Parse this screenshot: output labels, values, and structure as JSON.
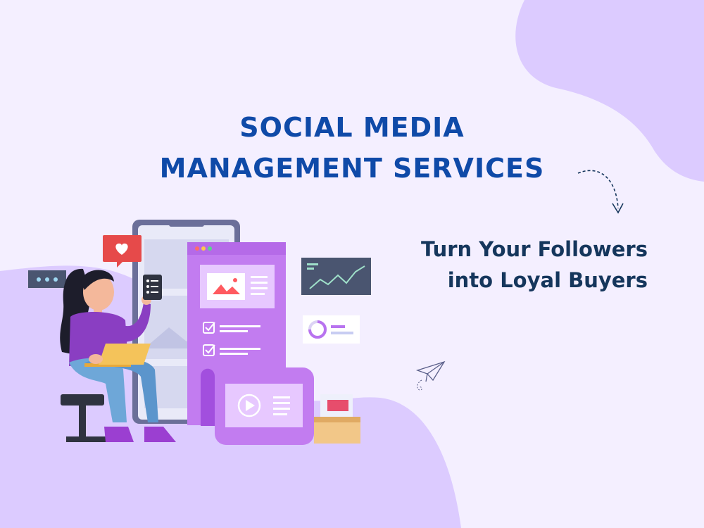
{
  "heading": {
    "line1": "SOCIAL MEDIA",
    "line2": "MANAGEMENT SERVICES"
  },
  "tagline": {
    "line1": "Turn Your Followers",
    "line2": "into Loyal Buyers"
  },
  "colors": {
    "background": "#f4efff",
    "blob": "#dccbff",
    "heading": "#0f4aa8",
    "tagline": "#15365c",
    "accent_purple": "#b873ef"
  },
  "icons": [
    "heart-icon",
    "chat-dots-icon",
    "checklist-icon",
    "image-icon",
    "checkbox-icon",
    "play-icon",
    "line-chart-icon",
    "donut-chart-icon",
    "paper-plane-icon",
    "curved-arrow-icon",
    "laptop-icon"
  ]
}
